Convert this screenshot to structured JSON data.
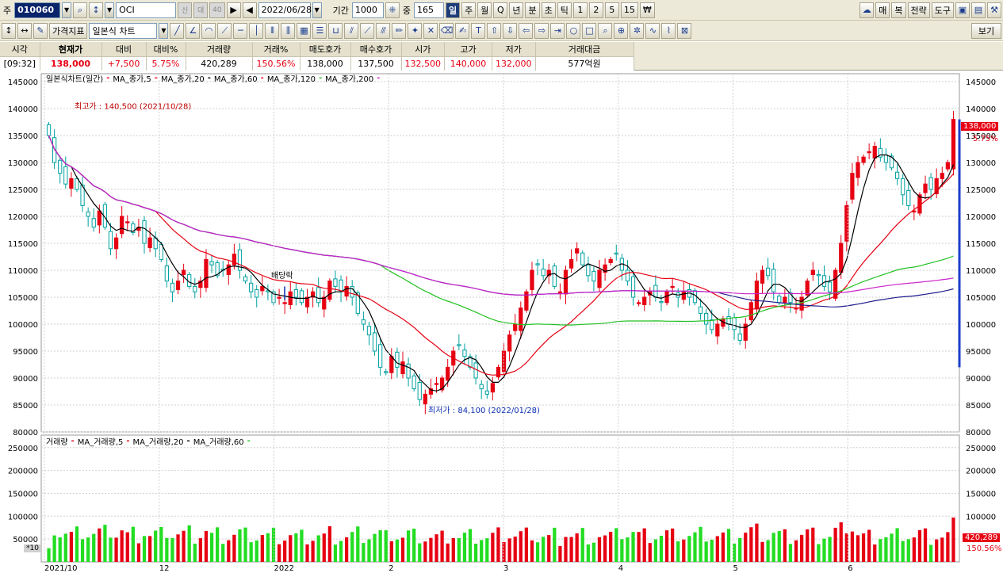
{
  "toolbar1": {
    "code_prefix": "주",
    "code": "010060",
    "name": "OCI",
    "flag_a": "신",
    "flag_b": "대",
    "flag_c": "40",
    "date": "2022/06/28",
    "period_label": "기간",
    "period": "1000",
    "count_label": "중",
    "count": "165",
    "intervals": [
      "일",
      "주",
      "월",
      "Q",
      "년",
      "분",
      "초",
      "틱",
      "1",
      "2",
      "5",
      "15",
      "₩"
    ],
    "right_buttons": [
      "매",
      "복",
      "전략",
      "도구"
    ]
  },
  "toolbar2": {
    "price_indicator": "가격지표",
    "chart_type": "일본식 차트",
    "view_button": "보기"
  },
  "info": {
    "headers": [
      "시각",
      "현재가",
      "대비",
      "대비%",
      "거래량",
      "거래%",
      "매도호가",
      "매수호가",
      "시가",
      "고가",
      "저가",
      "거래대금"
    ],
    "values": [
      "[09:32]",
      "138,000",
      "+7,500",
      "5.75%",
      "420,289",
      "150.56%",
      "138,000",
      "137,500",
      "132,500",
      "140,000",
      "132,000",
      "577억원"
    ]
  },
  "price_legend": {
    "title": "일본식차트(일간)",
    "items": [
      {
        "label": "MA_종가,5",
        "color": "#e60012"
      },
      {
        "label": "MA_종가,20",
        "color": "#000000"
      },
      {
        "label": "MA_종가,60",
        "color": "#e60012"
      },
      {
        "label": "MA_종가,120",
        "color": "#22c022"
      },
      {
        "label": "MA_종가,200",
        "color": "#1c1c8c"
      }
    ],
    "last_color": "#cc22cc"
  },
  "volume_legend": {
    "title": "거래량",
    "items": [
      {
        "label": "MA_거래량,5",
        "color": "#e60012"
      },
      {
        "label": "MA_거래량,20",
        "color": "#000000"
      },
      {
        "label": "MA_거래량,60",
        "color": "#e60012"
      }
    ],
    "last_color": "#22c022"
  },
  "annotations": {
    "high": "최고가 : 140,500 (2021/10/28)",
    "low": "최저가 : 84,100 (2022/01/28)",
    "dividend": "배당락",
    "price_badge": "138,000",
    "pct_badge": "5.75%",
    "vol_badge": "420,289",
    "vol_pct_badge": "150.56%",
    "vol_unit": "*10"
  },
  "colors": {
    "up": "#e60012",
    "down": "#00a0a0",
    "vol_up": "#e60012",
    "vol_down": "#22dd22",
    "grid": "#d0d0d0"
  },
  "chart_data": {
    "type": "candlestick",
    "price_axis": {
      "min": 80000,
      "max": 145000,
      "ticks": [
        145000,
        140000,
        135000,
        130000,
        125000,
        120000,
        115000,
        110000,
        105000,
        100000,
        95000,
        90000,
        85000,
        80000
      ]
    },
    "volume_axis": {
      "min": 0,
      "max": 260000,
      "ticks": [
        250000,
        200000,
        150000,
        100000,
        50000
      ]
    },
    "x_labels": [
      "2021/10",
      "12",
      "2022",
      "2",
      "3",
      "4",
      "5",
      "6"
    ],
    "current_price": 138000,
    "high": {
      "value": 140500,
      "date": "2021/10/28"
    },
    "low": {
      "value": 84100,
      "date": "2022/01/28"
    },
    "close": [
      135000,
      130000,
      128000,
      126000,
      127000,
      125000,
      122000,
      120000,
      118000,
      121000,
      118000,
      114000,
      116000,
      120000,
      119000,
      117000,
      118000,
      115000,
      116000,
      114000,
      112000,
      108000,
      106000,
      108000,
      110000,
      107000,
      106000,
      108000,
      112000,
      111000,
      109000,
      110000,
      111000,
      113000,
      110000,
      108000,
      106000,
      105000,
      107000,
      106000,
      104000,
      105000,
      104000,
      106000,
      105000,
      104000,
      105000,
      106000,
      104000,
      105000,
      108000,
      107000,
      106000,
      107000,
      105000,
      102000,
      100000,
      98000,
      95000,
      92000,
      91000,
      94000,
      92000,
      93000,
      90000,
      88000,
      86000,
      87000,
      88000,
      89000,
      90000,
      92000,
      95000,
      96000,
      94000,
      92000,
      90000,
      88000,
      87000,
      89000,
      92000,
      95000,
      98000,
      100000,
      103000,
      106000,
      110000,
      111000,
      109000,
      110000,
      107000,
      106000,
      110000,
      112000,
      114000,
      111000,
      109000,
      108000,
      110000,
      111000,
      112000,
      113000,
      110000,
      108000,
      105000,
      104000,
      105000,
      106000,
      105000,
      104000,
      106000,
      107000,
      105000,
      106000,
      105000,
      104000,
      102000,
      100000,
      99000,
      100000,
      101000,
      100000,
      99000,
      97000,
      100000,
      104000,
      108000,
      110000,
      109000,
      106000,
      104000,
      105000,
      104000,
      103000,
      105000,
      108000,
      110000,
      109000,
      107000,
      106000,
      110000,
      115000,
      122000,
      128000,
      130000,
      131000,
      132000,
      133000,
      131000,
      130000,
      129000,
      127000,
      124000,
      122000,
      121000,
      124000,
      126000,
      125000,
      127000,
      128000,
      130000,
      138000
    ]
  }
}
